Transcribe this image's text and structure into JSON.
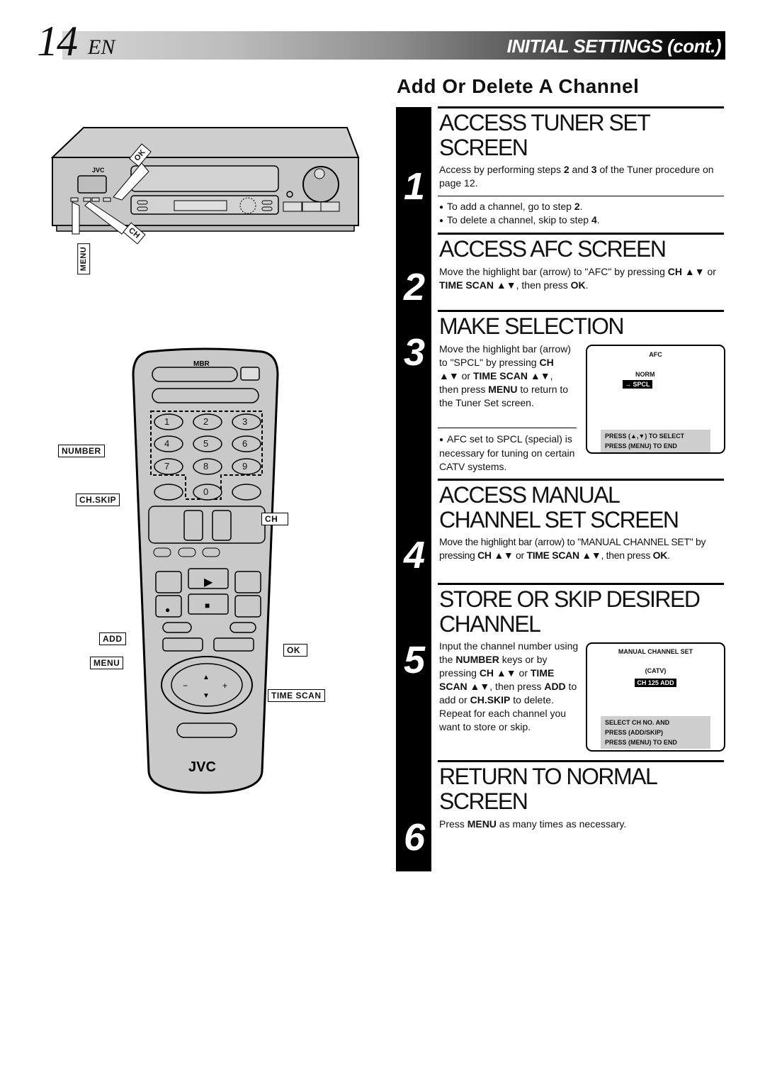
{
  "header": {
    "page_number": "14",
    "language": "EN",
    "section_title": "INITIAL SETTINGS (cont.)"
  },
  "subtitle": "Add Or Delete A Channel",
  "steps": [
    {
      "number": "1",
      "title_line1": "ACCESS TUNER SET",
      "title_line2": "SCREEN",
      "text": "Access by performing steps <b>2</b> and <b>3</b> of the Tuner procedure on page 12.",
      "bullets": [
        "To add a channel, go to step <b>2</b>.",
        "To delete a channel, skip to step <b>4</b>."
      ]
    },
    {
      "number": "2",
      "title_line1": "ACCESS AFC SCREEN",
      "text": "Move the highlight bar (arrow) to \"AFC\" by pressing <b>CH ▲▼</b> or <b>TIME SCAN ▲▼</b>, then press <b>OK</b>."
    },
    {
      "number": "3",
      "title_line1": "MAKE SELECTION",
      "text": "Move the highlight bar (arrow) to \"SPCL\" by pressing <b>CH ▲▼</b> or <b>TIME SCAN ▲▼</b>, then press <b>MENU</b> to return to the Tuner Set screen.",
      "bullets": [
        "AFC set to SPCL (special) is necessary for tuning on certain CATV systems."
      ],
      "osd": {
        "title": "AFC",
        "option1": "NORM",
        "option2_selected": "→ SPCL",
        "footer": [
          "PRESS (▲,▼) TO SELECT",
          "PRESS (MENU) TO END"
        ]
      }
    },
    {
      "number": "4",
      "title_line1": "ACCESS MANUAL",
      "title_line2": "CHANNEL SET SCREEN",
      "text": "Move the highlight bar (arrow) to \"MANUAL CHANNEL SET\" by pressing <b>CH ▲▼</b> or <b>TIME SCAN ▲▼</b>, then press <b>OK</b>."
    },
    {
      "number": "5",
      "title_line1": "STORE OR SKIP DESIRED",
      "title_line2": "CHANNEL",
      "text": "Input the channel number using the <b>NUMBER</b> keys or by pressing <b>CH ▲▼</b> or <b>TIME SCAN ▲▼</b>, then press <b>ADD</b> to add or <b>CH.SKIP</b> to delete. Repeat for each channel you want to store or skip.",
      "osd": {
        "title": "MANUAL CHANNEL SET",
        "line1": "(CATV)",
        "selected": "CH 125 ADD",
        "footer": [
          "SELECT CH NO. AND",
          "PRESS (ADD/SKIP)",
          "PRESS (MENU) TO END"
        ]
      }
    },
    {
      "number": "6",
      "title_line1": "RETURN TO NORMAL",
      "title_line2": "SCREEN",
      "text": "Press <b>MENU</b> as many times as necessary."
    }
  ],
  "vcr_illustration": {
    "brand": "JVC",
    "callouts": {
      "ok": "OK",
      "ch": "CH",
      "menu": "MENU"
    }
  },
  "remote_illustration": {
    "top_logo": "MBR",
    "brand": "JVC",
    "keys": [
      "1",
      "2",
      "3",
      "4",
      "5",
      "6",
      "7",
      "8",
      "9",
      "0"
    ],
    "callouts": {
      "number": "NUMBER",
      "ch_skip": "CH.SKIP",
      "ch": "CH",
      "add": "ADD",
      "menu": "MENU",
      "ok": "OK",
      "time_scan": "TIME SCAN"
    }
  }
}
